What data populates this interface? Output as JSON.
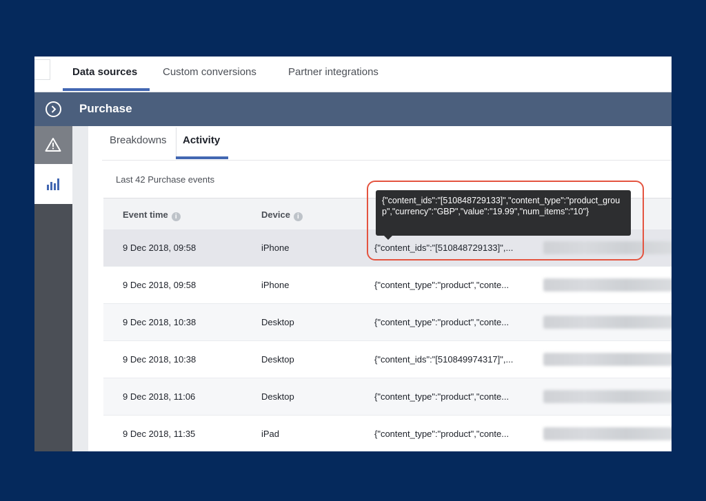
{
  "top_tabs": [
    {
      "label": "Data sources",
      "active": true
    },
    {
      "label": "Custom conversions",
      "active": false
    },
    {
      "label": "Partner integrations",
      "active": false
    }
  ],
  "header": {
    "title": "Purchase",
    "expand_icon": "chevron-right-circle-icon"
  },
  "sidenav": {
    "items": [
      "warning-triangle-icon",
      "bar-chart-icon"
    ]
  },
  "sub_tabs": [
    {
      "label": "Breakdowns",
      "active": false
    },
    {
      "label": "Activity",
      "active": true
    }
  ],
  "events_caption": "Last 42 Purchase events",
  "table": {
    "columns": [
      "Event time",
      "Device"
    ],
    "rows": [
      {
        "time": "9 Dec 2018, 09:58",
        "device": "iPhone",
        "params": "{\"content_ids\":\"[510848729133]\",..."
      },
      {
        "time": "9 Dec 2018, 09:58",
        "device": "iPhone",
        "params": "{\"content_type\":\"product\",\"conte..."
      },
      {
        "time": "9 Dec 2018, 10:38",
        "device": "Desktop",
        "params": "{\"content_type\":\"product\",\"conte..."
      },
      {
        "time": "9 Dec 2018, 10:38",
        "device": "Desktop",
        "params": "{\"content_ids\":\"[510849974317]\",..."
      },
      {
        "time": "9 Dec 2018, 11:06",
        "device": "Desktop",
        "params": "{\"content_type\":\"product\",\"conte..."
      },
      {
        "time": "9 Dec 2018, 11:35",
        "device": "iPad",
        "params": "{\"content_type\":\"product\",\"conte..."
      }
    ]
  },
  "tooltip": {
    "text": "{\"content_ids\":\"[510848729133]\",\"content_type\":\"product_group\",\"currency\":\"GBP\",\"value\":\"19.99\",\"num_items\":\"10\"}"
  },
  "colors": {
    "background": "#05295c",
    "header_bar": "#4b5f7d",
    "accent": "#4267b2",
    "highlight_border": "#e4533f",
    "tooltip_bg": "#2d2e30"
  }
}
